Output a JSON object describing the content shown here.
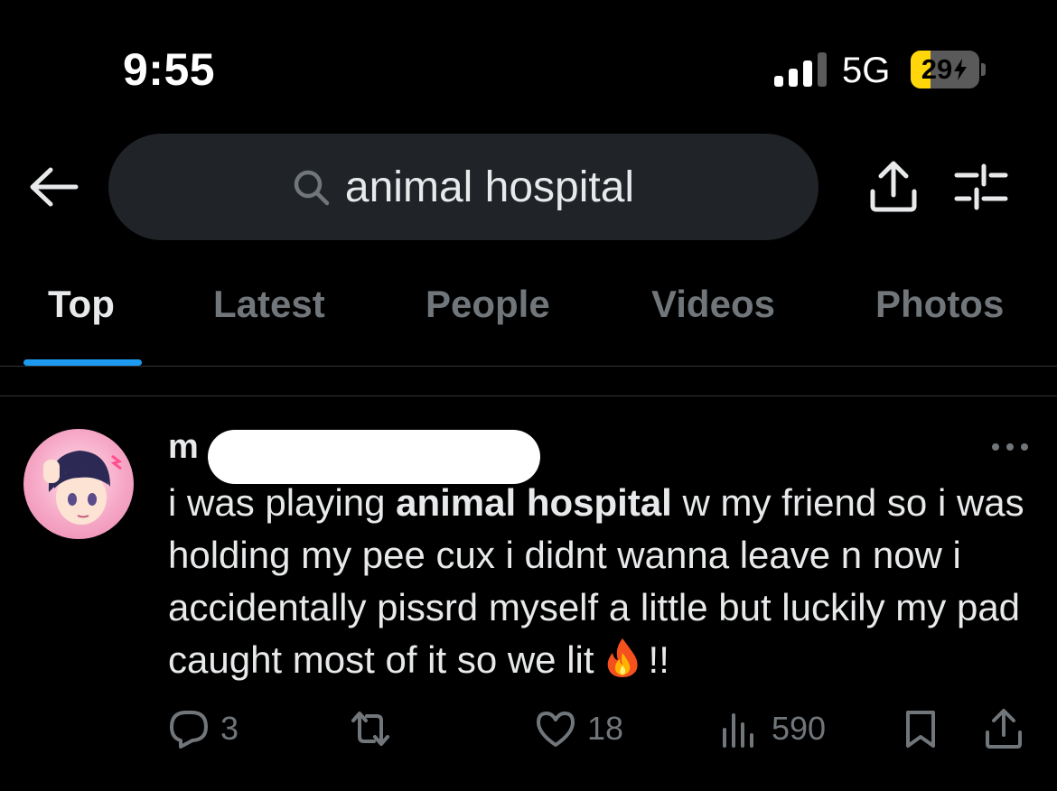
{
  "status_bar": {
    "time": "9:55",
    "network": "5G",
    "battery": "29",
    "battery_level": 0.29
  },
  "search": {
    "query": "animal hospital"
  },
  "tabs": [
    {
      "label": "Top",
      "active": true
    },
    {
      "label": "Latest",
      "active": false
    },
    {
      "label": "People",
      "active": false
    },
    {
      "label": "Videos",
      "active": false
    },
    {
      "label": "Photos",
      "active": false
    }
  ],
  "tweet": {
    "handle_visible": "m",
    "text_before": "i was playing ",
    "text_bold": "animal hospital",
    "text_after": " w my friend so i was holding my pee cux i didnt wanna leave n now i accidentally pissrd myself a little but luckily my pad caught most of it so we lit",
    "text_end": "!!",
    "emoji": "fire",
    "replies": "3",
    "reposts": "",
    "likes": "18",
    "views": "590"
  },
  "colors": {
    "background": "#000000",
    "muted": "#71767b",
    "accent": "#1d9bf0",
    "battery": "#ffd60a",
    "search_bg": "#202327"
  },
  "icons": [
    "back-arrow-icon",
    "search-icon",
    "share-icon",
    "filter-icon",
    "more-icon",
    "reply-icon",
    "repost-icon",
    "like-icon",
    "views-icon",
    "bookmark-icon",
    "fire-emoji-icon"
  ]
}
